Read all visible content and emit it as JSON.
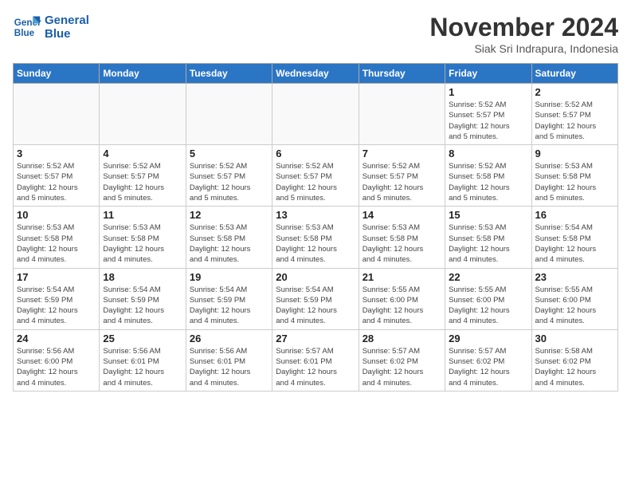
{
  "header": {
    "logo_line1": "General",
    "logo_line2": "Blue",
    "month": "November 2024",
    "location": "Siak Sri Indrapura, Indonesia"
  },
  "weekdays": [
    "Sunday",
    "Monday",
    "Tuesday",
    "Wednesday",
    "Thursday",
    "Friday",
    "Saturday"
  ],
  "weeks": [
    [
      {
        "day": "",
        "info": ""
      },
      {
        "day": "",
        "info": ""
      },
      {
        "day": "",
        "info": ""
      },
      {
        "day": "",
        "info": ""
      },
      {
        "day": "",
        "info": ""
      },
      {
        "day": "1",
        "info": "Sunrise: 5:52 AM\nSunset: 5:57 PM\nDaylight: 12 hours\nand 5 minutes."
      },
      {
        "day": "2",
        "info": "Sunrise: 5:52 AM\nSunset: 5:57 PM\nDaylight: 12 hours\nand 5 minutes."
      }
    ],
    [
      {
        "day": "3",
        "info": "Sunrise: 5:52 AM\nSunset: 5:57 PM\nDaylight: 12 hours\nand 5 minutes."
      },
      {
        "day": "4",
        "info": "Sunrise: 5:52 AM\nSunset: 5:57 PM\nDaylight: 12 hours\nand 5 minutes."
      },
      {
        "day": "5",
        "info": "Sunrise: 5:52 AM\nSunset: 5:57 PM\nDaylight: 12 hours\nand 5 minutes."
      },
      {
        "day": "6",
        "info": "Sunrise: 5:52 AM\nSunset: 5:57 PM\nDaylight: 12 hours\nand 5 minutes."
      },
      {
        "day": "7",
        "info": "Sunrise: 5:52 AM\nSunset: 5:57 PM\nDaylight: 12 hours\nand 5 minutes."
      },
      {
        "day": "8",
        "info": "Sunrise: 5:52 AM\nSunset: 5:58 PM\nDaylight: 12 hours\nand 5 minutes."
      },
      {
        "day": "9",
        "info": "Sunrise: 5:53 AM\nSunset: 5:58 PM\nDaylight: 12 hours\nand 5 minutes."
      }
    ],
    [
      {
        "day": "10",
        "info": "Sunrise: 5:53 AM\nSunset: 5:58 PM\nDaylight: 12 hours\nand 4 minutes."
      },
      {
        "day": "11",
        "info": "Sunrise: 5:53 AM\nSunset: 5:58 PM\nDaylight: 12 hours\nand 4 minutes."
      },
      {
        "day": "12",
        "info": "Sunrise: 5:53 AM\nSunset: 5:58 PM\nDaylight: 12 hours\nand 4 minutes."
      },
      {
        "day": "13",
        "info": "Sunrise: 5:53 AM\nSunset: 5:58 PM\nDaylight: 12 hours\nand 4 minutes."
      },
      {
        "day": "14",
        "info": "Sunrise: 5:53 AM\nSunset: 5:58 PM\nDaylight: 12 hours\nand 4 minutes."
      },
      {
        "day": "15",
        "info": "Sunrise: 5:53 AM\nSunset: 5:58 PM\nDaylight: 12 hours\nand 4 minutes."
      },
      {
        "day": "16",
        "info": "Sunrise: 5:54 AM\nSunset: 5:58 PM\nDaylight: 12 hours\nand 4 minutes."
      }
    ],
    [
      {
        "day": "17",
        "info": "Sunrise: 5:54 AM\nSunset: 5:59 PM\nDaylight: 12 hours\nand 4 minutes."
      },
      {
        "day": "18",
        "info": "Sunrise: 5:54 AM\nSunset: 5:59 PM\nDaylight: 12 hours\nand 4 minutes."
      },
      {
        "day": "19",
        "info": "Sunrise: 5:54 AM\nSunset: 5:59 PM\nDaylight: 12 hours\nand 4 minutes."
      },
      {
        "day": "20",
        "info": "Sunrise: 5:54 AM\nSunset: 5:59 PM\nDaylight: 12 hours\nand 4 minutes."
      },
      {
        "day": "21",
        "info": "Sunrise: 5:55 AM\nSunset: 6:00 PM\nDaylight: 12 hours\nand 4 minutes."
      },
      {
        "day": "22",
        "info": "Sunrise: 5:55 AM\nSunset: 6:00 PM\nDaylight: 12 hours\nand 4 minutes."
      },
      {
        "day": "23",
        "info": "Sunrise: 5:55 AM\nSunset: 6:00 PM\nDaylight: 12 hours\nand 4 minutes."
      }
    ],
    [
      {
        "day": "24",
        "info": "Sunrise: 5:56 AM\nSunset: 6:00 PM\nDaylight: 12 hours\nand 4 minutes."
      },
      {
        "day": "25",
        "info": "Sunrise: 5:56 AM\nSunset: 6:01 PM\nDaylight: 12 hours\nand 4 minutes."
      },
      {
        "day": "26",
        "info": "Sunrise: 5:56 AM\nSunset: 6:01 PM\nDaylight: 12 hours\nand 4 minutes."
      },
      {
        "day": "27",
        "info": "Sunrise: 5:57 AM\nSunset: 6:01 PM\nDaylight: 12 hours\nand 4 minutes."
      },
      {
        "day": "28",
        "info": "Sunrise: 5:57 AM\nSunset: 6:02 PM\nDaylight: 12 hours\nand 4 minutes."
      },
      {
        "day": "29",
        "info": "Sunrise: 5:57 AM\nSunset: 6:02 PM\nDaylight: 12 hours\nand 4 minutes."
      },
      {
        "day": "30",
        "info": "Sunrise: 5:58 AM\nSunset: 6:02 PM\nDaylight: 12 hours\nand 4 minutes."
      }
    ]
  ]
}
